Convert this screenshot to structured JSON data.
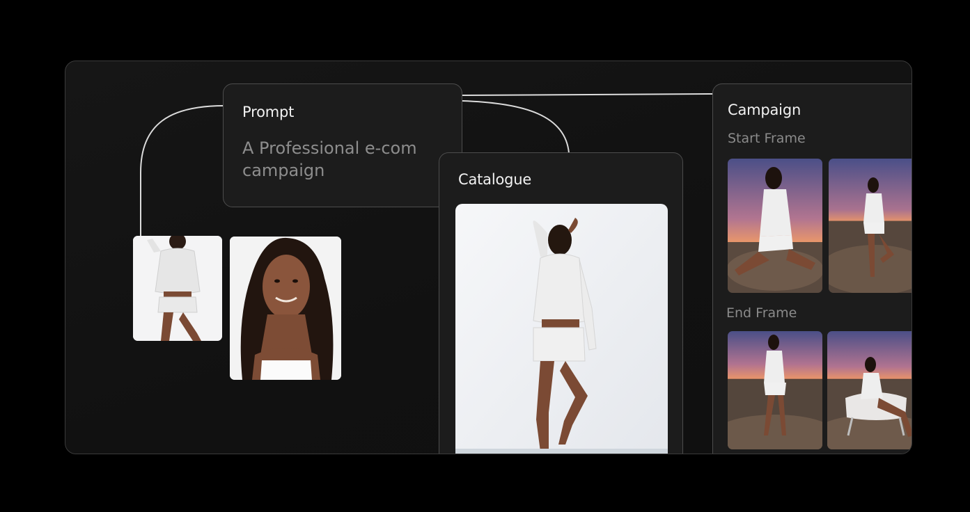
{
  "prompt_node": {
    "title": "Prompt",
    "text": "A Professional e-com campaign"
  },
  "catalogue_node": {
    "title": "Catalogue"
  },
  "campaign_node": {
    "title": "Campaign",
    "start_label": "Start Frame",
    "end_label": "End Frame"
  },
  "colors": {
    "background": "#000000",
    "canvas": "#121212",
    "node_fill": "#1c1c1c",
    "node_border": "#4d4d4d",
    "wire": "#e0e0e0",
    "sunset_top": "#4a4f86",
    "sunset_mid": "#b0708a",
    "sunset_glow": "#e9956a"
  },
  "icons": {
    "reference_outfit_image": "model-full-body-photo",
    "reference_face_image": "model-portrait-photo",
    "catalogue_image": "catalogue-photo",
    "campaign_frames": "desert-sunset-photo"
  }
}
